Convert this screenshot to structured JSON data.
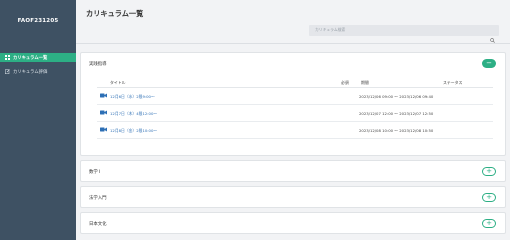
{
  "sidebar": {
    "brand": "FAOF231205",
    "items": [
      {
        "label": "カリキュラム一覧",
        "icon": "grid-icon",
        "active": true
      },
      {
        "label": "カリキュラム評価",
        "icon": "edit-icon",
        "active": false
      }
    ]
  },
  "header": {
    "title": "カリキュラム一覧",
    "search_placeholder": "カリキュラム検索"
  },
  "cards": [
    {
      "title": "実践指導",
      "expanded": true,
      "table": {
        "columns": [
          "タイトル",
          "必須",
          "期間",
          "ステータス"
        ],
        "rows": [
          {
            "title": "12月6日（水）2限9:00～",
            "period": "2023/12/06 09:00 ～ 2023/12/06 09:40"
          },
          {
            "title": "12月7日（木）4限12:00～",
            "period": "2023/12/07 12:00 ～ 2023/12/07 12:50"
          },
          {
            "title": "12月8日（金）2限10:00～",
            "period": "2023/12/08 10:00 ～ 2023/12/08 10:50"
          }
        ]
      }
    },
    {
      "title": "数学 I",
      "expanded": false
    },
    {
      "title": "法学入門",
      "expanded": false
    },
    {
      "title": "日本文化",
      "expanded": false
    }
  ],
  "colors": {
    "accent": "#2daf85",
    "sidebar": "#3e5163",
    "link": "#2d6fb5"
  }
}
